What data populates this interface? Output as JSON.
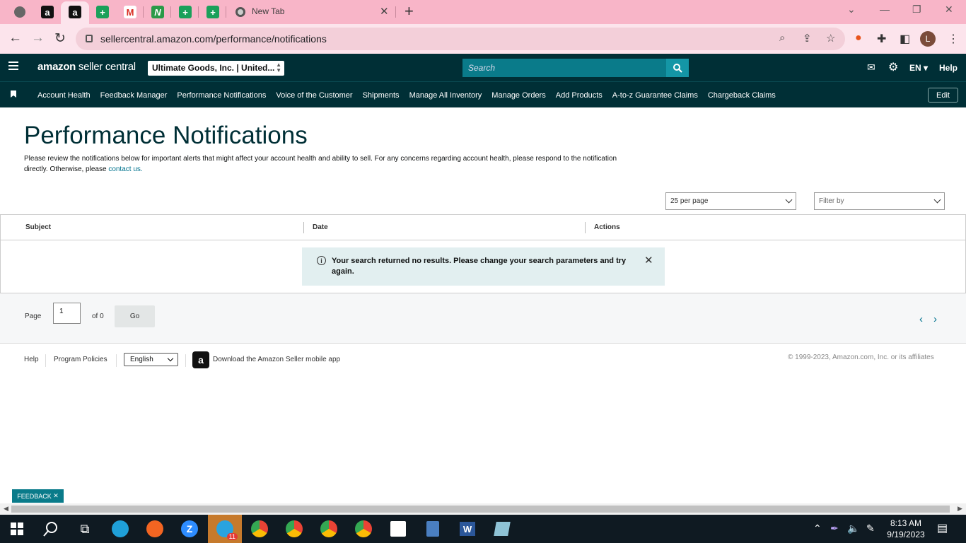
{
  "browser": {
    "tab_title": "New Tab",
    "url": "sellercentral.amazon.com/performance/notifications",
    "profile_initial": "L",
    "accent": "#f8b5c8"
  },
  "header": {
    "logo_bold": "amazon",
    "logo_rest": " seller central",
    "account": "Ultimate Goods, Inc. | United...",
    "search_placeholder": "Search",
    "language": "EN",
    "help": "Help",
    "brand_color": "#002f36"
  },
  "nav": {
    "items": [
      "Account Health",
      "Feedback Manager",
      "Performance Notifications",
      "Voice of the Customer",
      "Shipments",
      "Manage All Inventory",
      "Manage Orders",
      "Add Products",
      "A-to-z Guarantee Claims",
      "Chargeback Claims"
    ],
    "edit": "Edit"
  },
  "page": {
    "title": "Performance Notifications",
    "description": "Please review the notifications below for important alerts that might affect your account health and ability to sell. For any concerns regarding account health, please respond to the notification directly. Otherwise, please ",
    "contact_link": "contact us.",
    "per_page": "25 per page",
    "filter": "Filter by"
  },
  "table": {
    "columns": [
      "Subject",
      "Date",
      "Actions"
    ],
    "alert": "Your search returned no results. Please change your search parameters and try again."
  },
  "pager": {
    "page_label": "Page",
    "page_value": "1",
    "of_label": "of 0",
    "go": "Go"
  },
  "footer": {
    "help": "Help",
    "policies": "Program Policies",
    "language": "English",
    "app_text": "Download the Amazon Seller mobile app",
    "copyright": "© 1999-2023, Amazon.com, Inc. or its affiliates"
  },
  "feedback": "FEEDBACK",
  "taskbar": {
    "badge": "11",
    "time": "8:13 AM",
    "date": "9/19/2023"
  }
}
